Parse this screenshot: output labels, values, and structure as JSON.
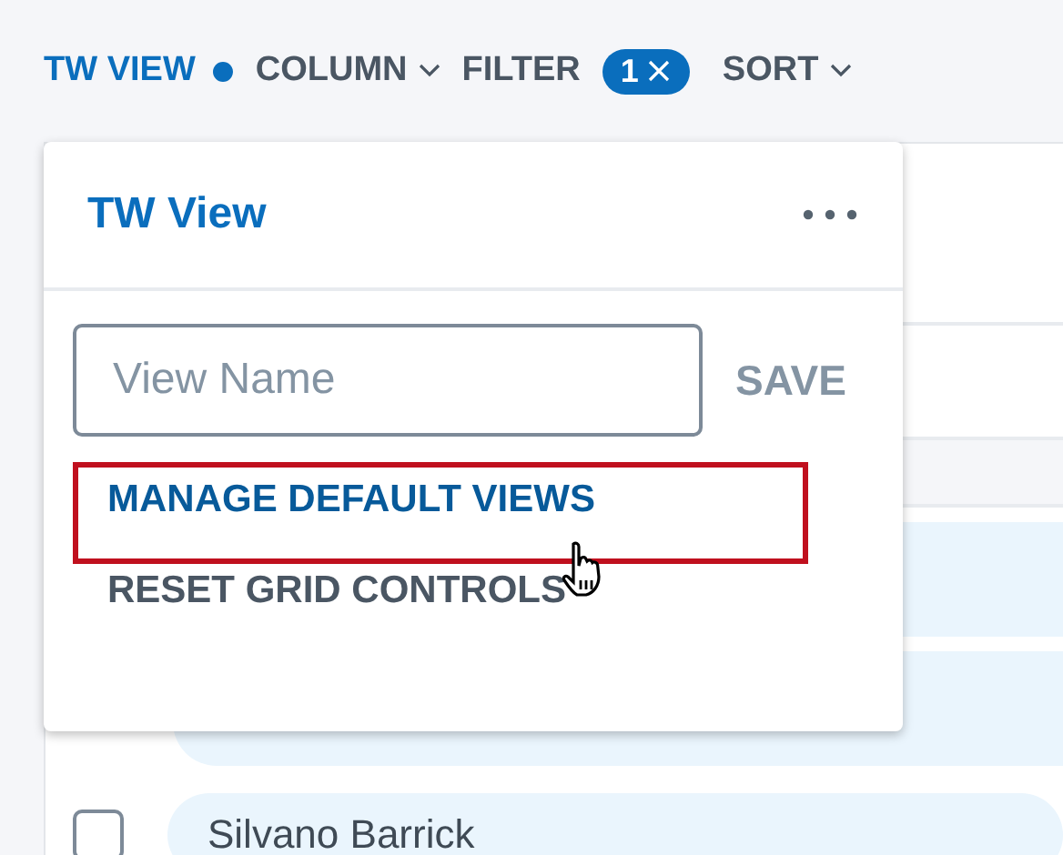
{
  "toolbar": [
    {
      "label": "TW VIEW",
      "kind": "dot",
      "active": true
    },
    {
      "label": "COLUMN",
      "kind": "dropdown",
      "active": false
    },
    {
      "label": "FILTER",
      "kind": "badge",
      "active": false,
      "badge": "1"
    },
    {
      "label": "SORT",
      "kind": "dropdown",
      "active": false
    }
  ],
  "popup": {
    "title": "TW View",
    "field": {
      "placeholder": "View Name"
    },
    "save": "SAVE",
    "items": [
      {
        "label": "MANAGE DEFAULT VIEWS",
        "selected": true
      },
      {
        "label": "RESET GRID CONTROLS",
        "selected": false
      }
    ]
  },
  "grid": {
    "rows": [
      {
        "kind": "header"
      },
      {
        "kind": "plain"
      },
      {
        "kind": "strip"
      },
      {
        "kind": "pill"
      },
      {
        "kind": "pill"
      },
      {
        "kind": "person",
        "name": "Silvano Barrick",
        "checked": false
      }
    ]
  }
}
